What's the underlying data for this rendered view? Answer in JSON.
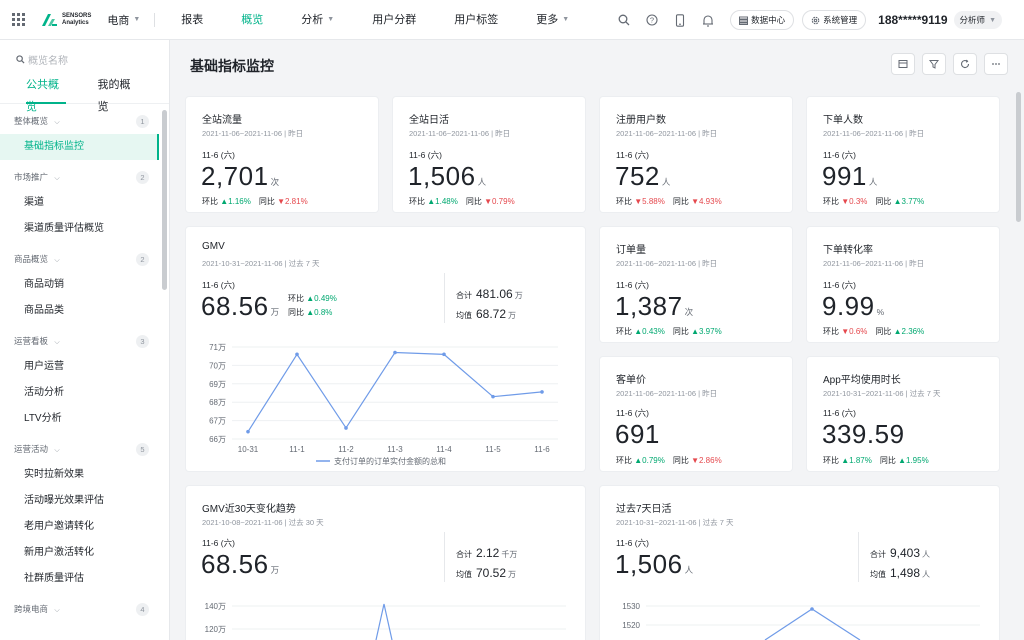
{
  "topnav": {
    "brand_line1": "SENSORS",
    "brand_line2": "Analytics",
    "project": "电商",
    "items": [
      {
        "label": "报表",
        "dropdown": false,
        "active": false
      },
      {
        "label": "概览",
        "dropdown": false,
        "active": true
      },
      {
        "label": "分析",
        "dropdown": true,
        "active": false
      },
      {
        "label": "用户分群",
        "dropdown": false,
        "active": false
      },
      {
        "label": "用户标签",
        "dropdown": false,
        "active": false
      },
      {
        "label": "更多",
        "dropdown": true,
        "active": false
      }
    ],
    "data_center": "数据中心",
    "system_admin": "系统管理",
    "phone": "188*****9119",
    "role": "分析师",
    "accent": "#00b38a"
  },
  "sidebar": {
    "search_placeholder": "概览名称",
    "tabs": [
      "公共概览",
      "我的概览"
    ],
    "groups": [
      {
        "name": "整体概览",
        "count": "1",
        "items": [
          "基础指标监控"
        ]
      },
      {
        "name": "市场推广",
        "count": "2",
        "items": [
          "渠道",
          "渠道质量评估概览"
        ]
      },
      {
        "name": "商品概览",
        "count": "2",
        "items": [
          "商品动销",
          "商品品类"
        ]
      },
      {
        "name": "运营看板",
        "count": "3",
        "items": [
          "用户运营",
          "活动分析",
          "LTV分析"
        ]
      },
      {
        "name": "运营活动",
        "count": "5",
        "items": [
          "实时拉新效果",
          "活动曝光效果评估",
          "老用户邀请转化",
          "新用户激活转化",
          "社群质量评估"
        ]
      },
      {
        "name": "跨境电商",
        "count": "4",
        "items": []
      }
    ],
    "active_item": "基础指标监控"
  },
  "main": {
    "title": "基础指标监控",
    "cards": {
      "traffic": {
        "title": "全站流量",
        "range": "2021-11-06~2021-11-06 | 昨日",
        "date": "11-6 (六)",
        "value": "2,701",
        "unit": "次",
        "hb_label": "环比",
        "hb": "1.16%",
        "hb_dir": "up",
        "tb_label": "同比",
        "tb": "2.81%",
        "tb_dir": "down"
      },
      "dau": {
        "title": "全站日活",
        "range": "2021-11-06~2021-11-06 | 昨日",
        "date": "11-6 (六)",
        "value": "1,506",
        "unit": "人",
        "hb_label": "环比",
        "hb": "1.48%",
        "hb_dir": "up",
        "tb_label": "同比",
        "tb": "0.79%",
        "tb_dir": "down"
      },
      "reg": {
        "title": "注册用户数",
        "range": "2021-11-06~2021-11-06 | 昨日",
        "date": "11-6 (六)",
        "value": "752",
        "unit": "人",
        "hb_label": "环比",
        "hb": "5.88%",
        "hb_dir": "down",
        "tb_label": "同比",
        "tb": "4.93%",
        "tb_dir": "down"
      },
      "buyers": {
        "title": "下单人数",
        "range": "2021-11-06~2021-11-06 | 昨日",
        "date": "11-6 (六)",
        "value": "991",
        "unit": "人",
        "hb_label": "环比",
        "hb": "0.3%",
        "hb_dir": "down",
        "tb_label": "同比",
        "tb": "3.77%",
        "tb_dir": "up"
      },
      "gmv": {
        "title": "GMV",
        "range": "2021-10-31~2021-11-06 | 过去 7 天",
        "date": "11-6 (六)",
        "value": "68.56",
        "unit": "万",
        "hb_label": "环比",
        "hb": "0.49%",
        "hb_dir": "up",
        "tb_label": "同比",
        "tb": "0.8%",
        "tb_dir": "up",
        "sum_label": "合计",
        "sum": "481.06",
        "sum_unit": "万",
        "avg_label": "均值",
        "avg": "68.72",
        "avg_unit": "万"
      },
      "orders": {
        "title": "订单量",
        "range": "2021-11-06~2021-11-06 | 昨日",
        "date": "11-6 (六)",
        "value": "1,387",
        "unit": "次",
        "hb_label": "环比",
        "hb": "0.43%",
        "hb_dir": "up",
        "tb_label": "同比",
        "tb": "3.97%",
        "tb_dir": "up"
      },
      "conv": {
        "title": "下单转化率",
        "range": "2021-11-06~2021-11-06 | 昨日",
        "date": "11-6 (六)",
        "value": "9.99",
        "unit": "%",
        "hb_label": "环比",
        "hb": "0.6%",
        "hb_dir": "down",
        "tb_label": "同比",
        "tb": "2.36%",
        "tb_dir": "up"
      },
      "aov": {
        "title": "客单价",
        "range": "2021-11-06~2021-11-06 | 昨日",
        "date": "11-6 (六)",
        "value": "691",
        "unit": "",
        "hb_label": "环比",
        "hb": "0.79%",
        "hb_dir": "up",
        "tb_label": "同比",
        "tb": "2.86%",
        "tb_dir": "down"
      },
      "app_time": {
        "title": "App平均使用时长",
        "range": "2021-10-31~2021-11-06 | 过去 7 天",
        "date": "11-6 (六)",
        "value": "339.59",
        "unit": "",
        "hb_label": "环比",
        "hb": "1.87%",
        "hb_dir": "up",
        "tb_label": "同比",
        "tb": "1.95%",
        "tb_dir": "up"
      },
      "gmv30": {
        "title": "GMV近30天变化趋势",
        "range": "2021-10-08~2021-11-06 | 过去 30 天",
        "date": "11-6 (六)",
        "value": "68.56",
        "unit": "万",
        "sum_label": "合计",
        "sum": "2.12",
        "sum_unit": "千万",
        "avg_label": "均值",
        "avg": "70.52",
        "avg_unit": "万"
      },
      "dau7": {
        "title": "过去7天日活",
        "range": "2021-10-31~2021-11-06 | 过去 7 天",
        "date": "11-6 (六)",
        "value": "1,506",
        "unit": "人",
        "sum_label": "合计",
        "sum": "9,403",
        "sum_unit": "人",
        "avg_label": "均值",
        "avg": "1,498",
        "avg_unit": "人"
      }
    }
  },
  "chart_data": [
    {
      "type": "line",
      "categories": [
        "10-31",
        "11-1",
        "11-2",
        "11-3",
        "11-4",
        "11-5",
        "11-6"
      ],
      "series": [
        {
          "name": "支付订单的订单实付金额的总和",
          "values": [
            66.4,
            70.6,
            66.6,
            70.7,
            70.6,
            68.3,
            68.56
          ]
        }
      ],
      "y_ticks": [
        "66万",
        "67万",
        "68万",
        "69万",
        "70万",
        "71万"
      ],
      "ylim": [
        66,
        71
      ],
      "grid": true,
      "legend": "bottom",
      "color": "#6f9be8"
    },
    {
      "type": "line",
      "y_ticks": [
        "120万",
        "140万"
      ],
      "ylim": [
        110,
        145
      ],
      "grid": true,
      "color": "#6f9be8",
      "partial": true
    },
    {
      "type": "line",
      "y_ticks": [
        "1520",
        "1530"
      ],
      "ylim": [
        1515,
        1533
      ],
      "grid": true,
      "color": "#6f9be8",
      "partial": true
    }
  ]
}
